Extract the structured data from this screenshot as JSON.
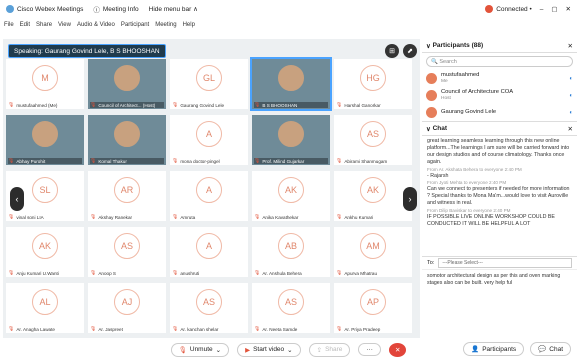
{
  "window": {
    "app_title": "Cisco Webex Meetings",
    "meeting_info": "Meeting Info",
    "hide_menu": "Hide menu bar ∧",
    "connected": "Connected •",
    "minimize": "–",
    "maximize": "▢",
    "close": "✕"
  },
  "menu": [
    "File",
    "Edit",
    "Share",
    "View",
    "Audio & Video",
    "Participant",
    "Meeting",
    "Help"
  ],
  "stage": {
    "speaking": "Speaking: Gaurang Govind Lele, B S BHOOSHAN",
    "layout_btn": "⊞",
    "view_btn": "⬈"
  },
  "tiles": [
    {
      "initials": "M",
      "name": "mustufaahmed (Me)",
      "photo": false
    },
    {
      "initials": "",
      "name": "Council of Architect... (Host)",
      "photo": true
    },
    {
      "initials": "GL",
      "name": "Gaurang Govind Lele",
      "photo": false
    },
    {
      "initials": "",
      "name": "B S BHOOSHAN",
      "photo": true,
      "active": true
    },
    {
      "initials": "HG",
      "name": "Harshal Ganorkar",
      "photo": false
    },
    {
      "initials": "",
      "name": "Abhay Purohit",
      "photo": true
    },
    {
      "initials": "",
      "name": "Komal Thakur",
      "photo": true
    },
    {
      "initials": "A",
      "name": "mona doctor-pingel",
      "photo": false
    },
    {
      "initials": "",
      "name": "Prof. Milind Gujarkar",
      "photo": true
    },
    {
      "initials": "AS",
      "name": "Abirami Shanmugam",
      "photo": false
    },
    {
      "initials": "SL",
      "name": "vinal soni LIA",
      "photo": false
    },
    {
      "initials": "AR",
      "name": "Akshay Ranekar",
      "photo": false
    },
    {
      "initials": "A",
      "name": "Amruta",
      "photo": false
    },
    {
      "initials": "AK",
      "name": "Anika Kavathekar",
      "photo": false
    },
    {
      "initials": "AK",
      "name": "Ankhu Kumari",
      "photo": false
    },
    {
      "initials": "AK",
      "name": "Anju Kumari U.Wanti",
      "photo": false
    },
    {
      "initials": "AS",
      "name": "Anoop S",
      "photo": false
    },
    {
      "initials": "A",
      "name": "anushruti",
      "photo": false
    },
    {
      "initials": "AB",
      "name": "Ar. Anshula Behera",
      "photo": false
    },
    {
      "initials": "AM",
      "name": "Apurva Mhatrau",
      "photo": false
    },
    {
      "initials": "AL",
      "name": "Ar. Anagha Lawate",
      "photo": false
    },
    {
      "initials": "AJ",
      "name": "Ar. Jaspreet",
      "photo": false
    },
    {
      "initials": "AS",
      "name": "Ar. kanchan shelar",
      "photo": false
    },
    {
      "initials": "AS",
      "name": "Ar. Neeta Samde",
      "photo": false
    },
    {
      "initials": "AP",
      "name": "Ar. Priya Pradeep",
      "photo": false
    }
  ],
  "controls": {
    "unmute": "Unmute",
    "start_video": "Start video",
    "share": "Share",
    "more": "···",
    "leave": "✕",
    "participants": "Participants",
    "chat": "Chat"
  },
  "participants_panel": {
    "title": "Participants (88)",
    "search_placeholder": "Search",
    "list": [
      {
        "name": "mustufaahmed",
        "role": "Me"
      },
      {
        "name": "Council of Architecture COA",
        "role": "Host"
      },
      {
        "name": "Gaurang Govind Lele",
        "role": ""
      }
    ]
  },
  "chat_panel": {
    "title": "Chat",
    "messages": [
      {
        "text": "great learning seamless learning through this new online platform...The learnings I am sure will be carried forward into our design studios and of course climatology. Thanks once again.",
        "meta": "From Ar. Akshata Behera to everyone   2:40 PM"
      },
      {
        "text": "- Rajarsh",
        "meta": "From Jyoti Mehta to everyone   2:40 PM"
      },
      {
        "text": "Can we connect to presenters if needed for more information ? Special thanks to Mona Ma'm...would love to visit Auroville and witness in real.",
        "meta": "From Dilip Baviskar to everyone   2:40 PM"
      },
      {
        "text": "IF POSSIBLE LIVE ONLINE WORKSHOP COULD BE CONDUCTED IT WILL BE HELPFUL A LOT",
        "meta": ""
      }
    ],
    "to_label": "To:",
    "to_select": "---Please Select---",
    "draft": "somotor architectural design as per this and oven marking stages also can be built. very help ful"
  }
}
